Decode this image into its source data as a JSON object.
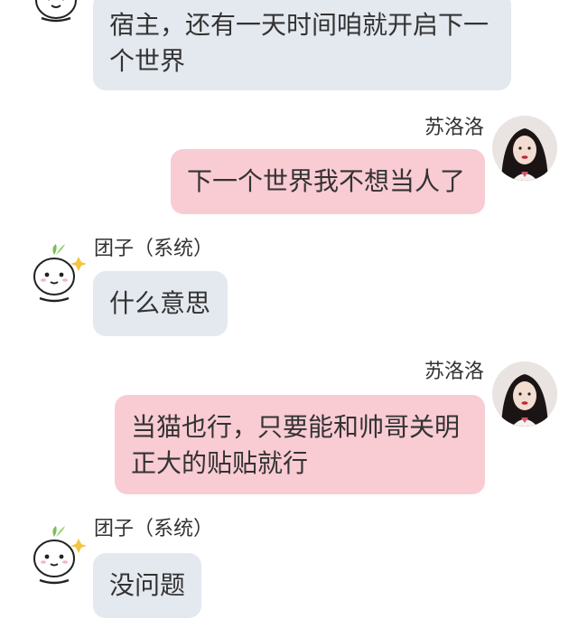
{
  "contacts": {
    "system_name": "团子（系统）",
    "user_name": "苏洛洛"
  },
  "messages": [
    {
      "side": "left",
      "sender": "",
      "lines": [
        "宿主，还有一天时间咱就开启下一",
        "个世界"
      ]
    },
    {
      "side": "right",
      "sender": "苏洛洛",
      "lines": [
        "下一个世界我不想当人了"
      ]
    },
    {
      "side": "left",
      "sender": "团子（系统）",
      "lines": [
        "什么意思"
      ]
    },
    {
      "side": "right",
      "sender": "苏洛洛",
      "lines": [
        "当猫也行，只要能和帅哥关明",
        "正大的贴贴就行"
      ]
    },
    {
      "side": "left",
      "sender": "团子（系统）",
      "lines": [
        "没问题"
      ]
    }
  ],
  "avatars": {
    "system": "cartoon-sprout-dumpling-avatar",
    "user": "girl-portrait-avatar"
  },
  "colors": {
    "left_bubble": "#e4e8ef",
    "right_bubble": "#f9cbd3",
    "background": "#ffffff"
  }
}
